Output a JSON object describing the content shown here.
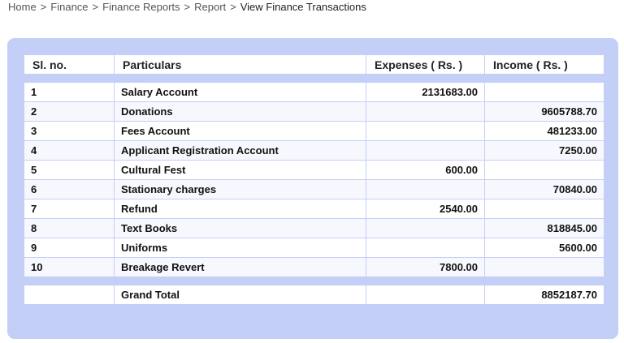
{
  "breadcrumb": {
    "items": [
      "Home",
      "Finance",
      "Finance Reports",
      "Report"
    ],
    "current": "View Finance Transactions",
    "separator": ">"
  },
  "table": {
    "headers": {
      "sl_no": "Sl. no.",
      "particulars": "Particulars",
      "expenses": "Expenses ( Rs. )",
      "income": "Income ( Rs. )"
    },
    "rows": [
      {
        "sl": "1",
        "particular": "Salary Account",
        "expense": "2131683.00",
        "income": ""
      },
      {
        "sl": "2",
        "particular": "Donations",
        "expense": "",
        "income": "9605788.70"
      },
      {
        "sl": "3",
        "particular": "Fees Account",
        "expense": "",
        "income": "481233.00"
      },
      {
        "sl": "4",
        "particular": "Applicant Registration Account",
        "expense": "",
        "income": "7250.00"
      },
      {
        "sl": "5",
        "particular": "Cultural Fest",
        "expense": "600.00",
        "income": ""
      },
      {
        "sl": "6",
        "particular": "Stationary charges",
        "expense": "",
        "income": "70840.00"
      },
      {
        "sl": "7",
        "particular": "Refund",
        "expense": "2540.00",
        "income": ""
      },
      {
        "sl": "8",
        "particular": "Text Books",
        "expense": "",
        "income": "818845.00"
      },
      {
        "sl": "9",
        "particular": "Uniforms",
        "expense": "",
        "income": "5600.00"
      },
      {
        "sl": "10",
        "particular": "Breakage Revert",
        "expense": "7800.00",
        "income": ""
      }
    ],
    "total": {
      "label": "Grand Total",
      "expense": "",
      "income": "8852187.70"
    }
  },
  "colors": {
    "panel": "#c3cff6",
    "cell": "#ffffff"
  }
}
